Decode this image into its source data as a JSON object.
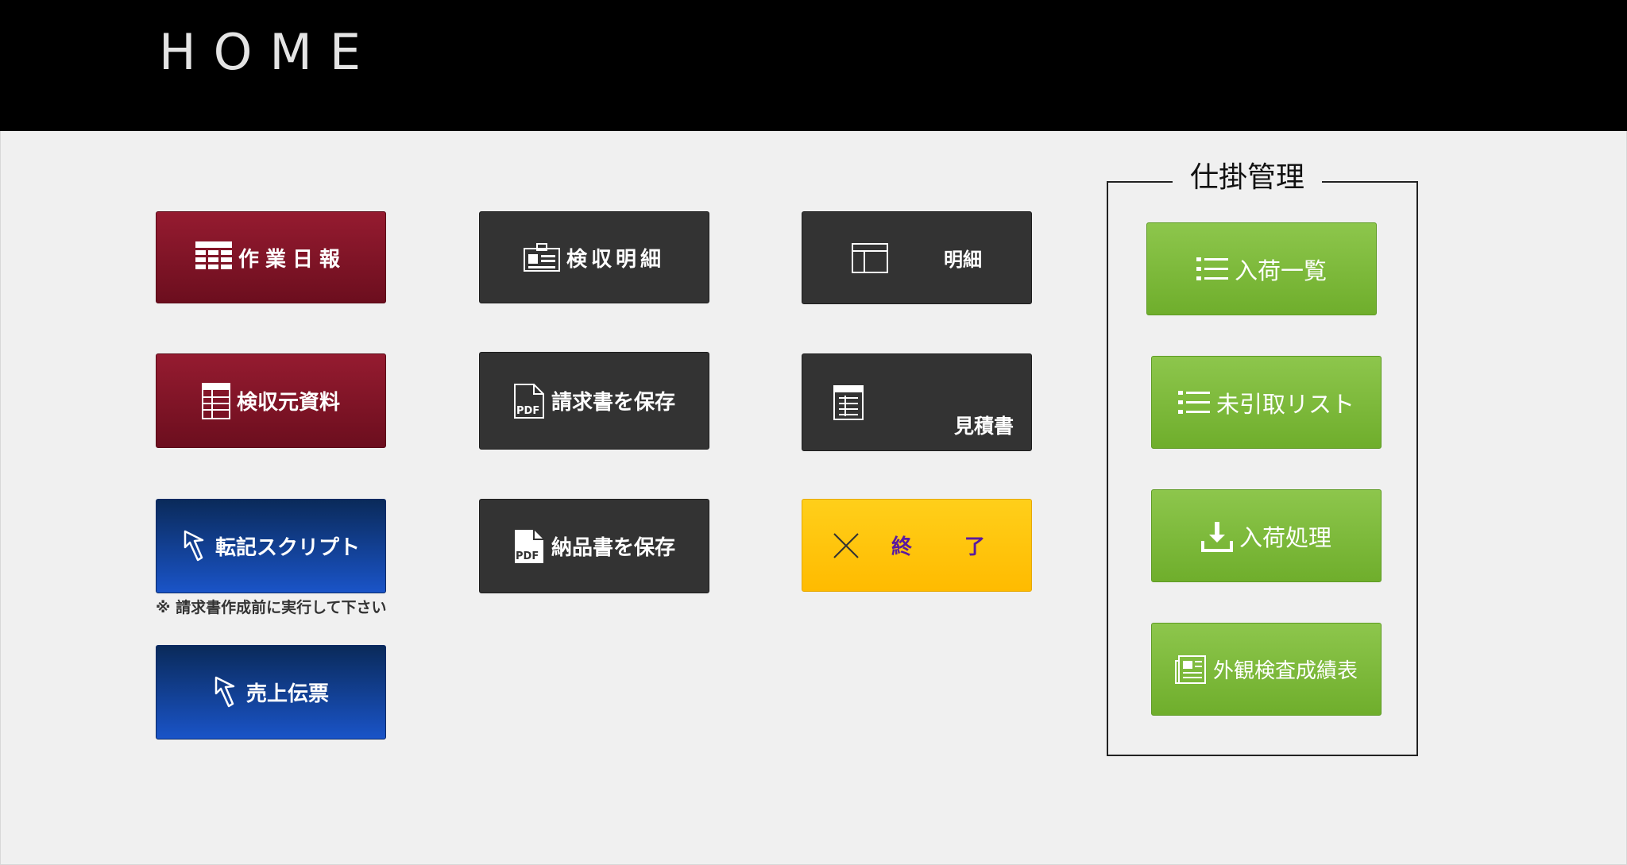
{
  "header": {
    "title": "HOME"
  },
  "buttons": {
    "sagyo_nippo": "作業日報",
    "kenshu_moto_shiryo": "検収元資料",
    "tenki_script": "転記スクリプト",
    "tenki_note": "※  請求書作成前に実行して下さい",
    "uriage_denpyo": "売上伝票",
    "kenshu_meisai": "検収明細",
    "seikyusho_hozon": "請求書を保存",
    "nohinsho_hozon": "納品書を保存",
    "meisai": "明細",
    "mitsumorisho": "見積書",
    "shuryo": "終　了"
  },
  "shikake": {
    "title": "仕掛管理",
    "items": [
      "入荷一覧",
      "未引取リスト",
      "入荷処理",
      "外観検査成績表"
    ]
  },
  "colors": {
    "red": "#7e1426",
    "dark": "#333333",
    "blue": "#1848b4",
    "yellow": "#ffc400",
    "green": "#7cba3a",
    "end_text": "#5a1aa0"
  }
}
